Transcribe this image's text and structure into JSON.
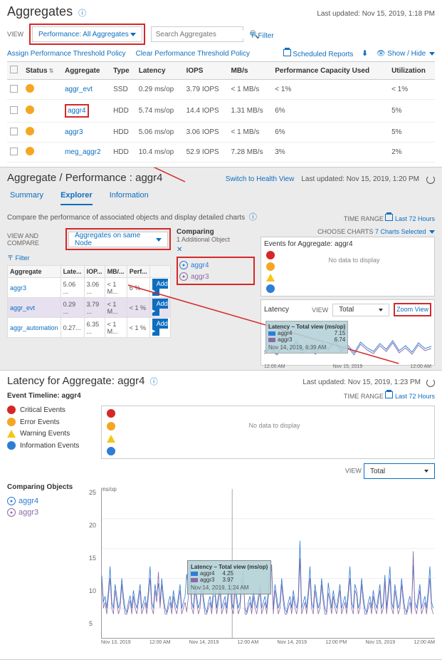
{
  "section1": {
    "title": "Aggregates",
    "last_updated": "Last updated: Nov 15, 2019, 1:18 PM",
    "view_label": "VIEW",
    "view_dropdown": "Performance: All Aggregates",
    "search_placeholder": "Search Aggregates",
    "filter_label": "Filter",
    "assign_policy": "Assign Performance Threshold Policy",
    "clear_policy": "Clear Performance Threshold Policy",
    "scheduled_reports": "Scheduled Reports",
    "show_hide": "Show / Hide",
    "columns": [
      "",
      "Status",
      "Aggregate",
      "Type",
      "Latency",
      "IOPS",
      "MB/s",
      "Performance Capacity Used",
      "Utilization"
    ],
    "rows": [
      {
        "status": "warn",
        "name": "aggr_evt",
        "type": "SSD",
        "latency": "0.29 ms/op",
        "iops": "3.79 IOPS",
        "mbs": "< 1 MB/s",
        "pcu": "< 1%",
        "util": "< 1%"
      },
      {
        "status": "warn",
        "name": "aggr4",
        "type": "HDD",
        "latency": "5.74 ms/op",
        "iops": "14.4 IOPS",
        "mbs": "1.31 MB/s",
        "pcu": "6%",
        "util": "5%",
        "highlight": true
      },
      {
        "status": "warn",
        "name": "aggr3",
        "type": "HDD",
        "latency": "5.06 ms/op",
        "iops": "3.06 IOPS",
        "mbs": "< 1 MB/s",
        "pcu": "6%",
        "util": "5%"
      },
      {
        "status": "warn",
        "name": "meg_aggr2",
        "type": "HDD",
        "latency": "10.4 ms/op",
        "iops": "52.9 IOPS",
        "mbs": "7.28 MB/s",
        "pcu": "3%",
        "util": "2%"
      }
    ]
  },
  "section2": {
    "title": "Aggregate / Performance : aggr4",
    "switch_link": "Switch to Health View",
    "last_updated": "Last updated: Nov 15, 2019, 1:20 PM",
    "tabs": [
      "Summary",
      "Explorer",
      "Information"
    ],
    "active_tab": "Explorer",
    "compare_text": "Compare the performance of associated objects and display detailed charts",
    "time_range_label": "TIME RANGE",
    "time_range": "Last 72 Hours",
    "view_compare_label": "VIEW AND COMPARE",
    "view_compare_dropdown": "Aggregates on same Node",
    "filter_label": "Filter",
    "compare_cols": [
      "Aggregate",
      "Late...",
      "IOP...",
      "MB/...",
      "Perf..."
    ],
    "compare_rows": [
      {
        "name": "aggr3",
        "lat": "5.06 ...",
        "iops": "3.06 ...",
        "mbs": "< 1 M...",
        "perf": "6 %",
        "add": true
      },
      {
        "name": "aggr_evt",
        "lat": "0.29 ...",
        "iops": "3.79 ...",
        "mbs": "< 1 M...",
        "perf": "< 1 %",
        "add": true,
        "selected": true
      },
      {
        "name": "aggr_automation",
        "lat": "0.27...",
        "iops": "6.35 ...",
        "mbs": "< 1 M...",
        "perf": "< 1 %",
        "add": true
      }
    ],
    "comparing_title": "Comparing",
    "comparing_sub": "1 Additional Object",
    "comparing_items": [
      {
        "name": "aggr4",
        "color": "#2e7dd6"
      },
      {
        "name": "aggr3",
        "color": "#8a6aa5"
      }
    ],
    "choose_charts_label": "CHOOSE CHARTS",
    "choose_charts": "7 Charts Selected",
    "events_title": "Events for Aggregate: aggr4",
    "no_data": "No data to display",
    "latency_label": "Latency",
    "latency_view_label": "VIEW",
    "latency_view": "Total",
    "zoom_view": "Zoom View",
    "latency_tooltip_title": "Latency – Total view (ms/op)",
    "latency_tooltip_rows": [
      {
        "name": "aggr4",
        "val": "7.15",
        "color": "#2e7dd6"
      },
      {
        "name": "aggr3",
        "val": "6.74",
        "color": "#8a6aa5"
      }
    ],
    "latency_tooltip_time": "Nov 14, 2019, 6:39 AM",
    "latency_xticks": [
      "12:00 AM",
      "Nov 15, 2019",
      "12:00 AM"
    ]
  },
  "section3": {
    "title": "Latency for Aggregate: aggr4",
    "last_updated": "Last updated: Nov 15, 2019, 1:23 PM",
    "event_timeline": "Event Timeline: aggr4",
    "time_range_label": "TIME RANGE",
    "time_range": "Last 72 Hours",
    "legend": [
      {
        "label": "Critical Events",
        "color": "#d62728",
        "cls": "red"
      },
      {
        "label": "Error Events",
        "color": "#f5a623",
        "cls": "orange"
      },
      {
        "label": "Warning Events",
        "color": "#f5c518",
        "cls": "tri"
      },
      {
        "label": "Information Events",
        "color": "#2e7dd6",
        "cls": "blue"
      }
    ],
    "no_data": "No data to display",
    "view_label": "VIEW",
    "view_dropdown": "Total",
    "comparing_title": "Comparing Objects",
    "comparing": [
      {
        "name": "aggr4",
        "color": "#2e7dd6"
      },
      {
        "name": "aggr3",
        "color": "#8a6aa5"
      }
    ],
    "y_unit": "ms/op",
    "y_ticks": [
      "25",
      "20",
      "15",
      "10",
      "5"
    ],
    "tooltip_title": "Latency – Total view (ms/op)",
    "tooltip_rows": [
      {
        "name": "aggr4",
        "val": "4.25",
        "color": "#2e7dd6"
      },
      {
        "name": "aggr3",
        "val": "3.97",
        "color": "#8a6aa5"
      }
    ],
    "tooltip_time": "Nov 14, 2019, 1:24 AM",
    "x_ticks": [
      "Nov 13, 2019",
      "12:00 AM",
      "Nov 14, 2019",
      "12:00 AM",
      "Nov 14, 2019",
      "12:00 PM",
      "Nov 15, 2019",
      "12:00 AM"
    ]
  },
  "add_label": "Add ▸",
  "chart_data": {
    "type": "line",
    "title": "Latency – Total view (ms/op)",
    "ylabel": "ms/op",
    "ylim": [
      0,
      25
    ],
    "x_range": [
      "Nov 13, 2019 00:00",
      "Nov 15, 2019 12:00"
    ],
    "series": [
      {
        "name": "aggr4",
        "color": "#2e7dd6",
        "sample_values": [
          5,
          6,
          7,
          5,
          8,
          12,
          6,
          5,
          9,
          7,
          5,
          6,
          10,
          7,
          5,
          4.25,
          6,
          7,
          5,
          8,
          6,
          5,
          7,
          9
        ]
      },
      {
        "name": "aggr3",
        "color": "#8a6aa5",
        "sample_values": [
          4,
          5,
          6,
          4,
          7,
          10,
          5,
          4,
          8,
          6,
          4,
          5,
          9,
          6,
          4,
          3.97,
          5,
          6,
          4,
          7,
          5,
          4,
          6,
          8
        ]
      }
    ]
  }
}
